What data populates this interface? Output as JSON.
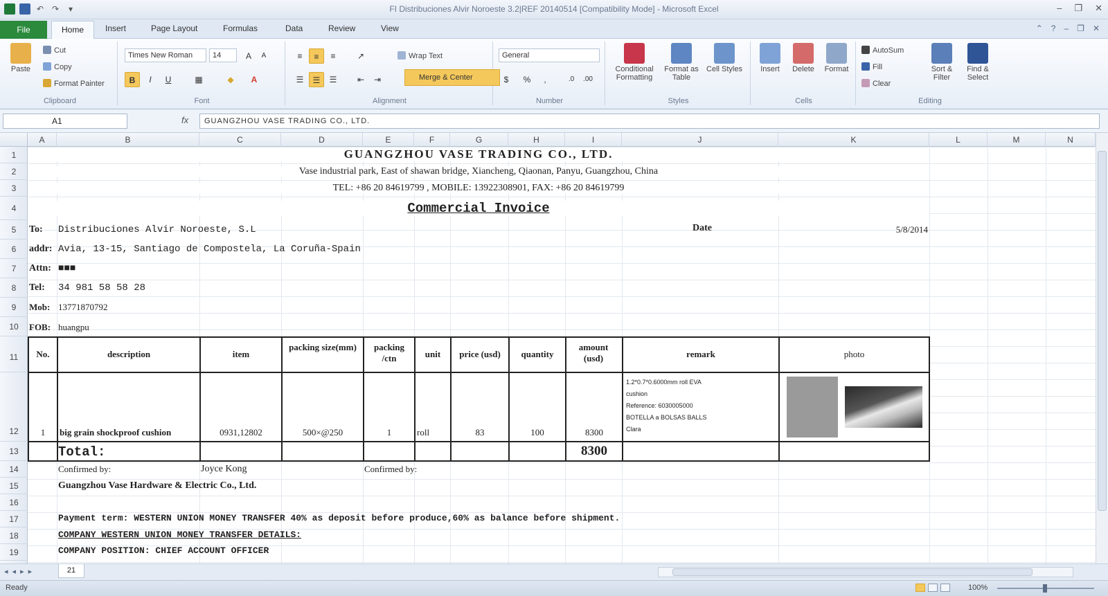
{
  "window": {
    "title": "FI Distribuciones Alvir Noroeste 3.2|REF 20140514 [Compatibility Mode] - Microsoft Excel"
  },
  "ribbon_tabs": [
    "File",
    "Home",
    "Insert",
    "Page Layout",
    "Formulas",
    "Data",
    "Review",
    "View"
  ],
  "ribbon": {
    "clipboard": {
      "label": "Clipboard",
      "paste": "Paste",
      "cut": "Cut",
      "copy": "Copy",
      "format_painter": "Format Painter"
    },
    "font": {
      "label": "Font",
      "name": "Times New Roman",
      "size": "14"
    },
    "alignment": {
      "label": "Alignment",
      "wrap_text": "Wrap Text",
      "merge_center": "Merge & Center"
    },
    "number": {
      "label": "Number",
      "format": "General"
    },
    "styles": {
      "label": "Styles",
      "conditional": "Conditional Formatting",
      "format_table": "Format as Table",
      "cell_styles": "Cell Styles"
    },
    "cells": {
      "label": "Cells",
      "insert": "Insert",
      "delete": "Delete",
      "format": "Format"
    },
    "editing": {
      "label": "Editing",
      "autosum": "AutoSum",
      "fill": "Fill",
      "clear": "Clear",
      "sort_filter": "Sort & Filter",
      "find_select": "Find & Select"
    }
  },
  "formula_bar": {
    "name_box": "A1",
    "fx": "fx",
    "content": "GUANGZHOU VASE TRADING CO., LTD."
  },
  "columns": [
    "A",
    "B",
    "C",
    "D",
    "E",
    "F",
    "G",
    "H",
    "I",
    "J",
    "K",
    "L",
    "M",
    "N"
  ],
  "rows": [
    "1",
    "2",
    "3",
    "4",
    "5",
    "6",
    "7",
    "8",
    "9",
    "10",
    "11",
    "12",
    "13",
    "14",
    "15",
    "16",
    "17",
    "18",
    "19"
  ],
  "invoice": {
    "company": "GUANGZHOU VASE TRADING CO., LTD.",
    "address": "Vase industrial park, East of shawan bridge, Xiancheng, Qiaonan, Panyu, Guangzhou, China",
    "contact": "TEL: +86 20 84619799 , MOBILE: 13922308901, FAX: +86 20 84619799",
    "doc_title": "Commercial Invoice",
    "to_label": "To:",
    "to_value": "Distribuciones Alvir Noroeste, S.L",
    "addr_label": "addr:",
    "addr_value": "Avia, 13-15, Santiago de Compostela, La Coruña-Spain",
    "attn_label": "Attn:",
    "attn_value": "■■■",
    "tel_label": "Tel:",
    "tel_value": "34 981 58 58 28",
    "mob_label": "Mob:",
    "mob_value": "13771870792",
    "fob_label": "FOB:",
    "fob_value": "huangpu",
    "date_label": "Date",
    "date_value": "5/8/2014",
    "headers": [
      "No.",
      "description",
      "item",
      "packing size(mm)",
      "packing /ctn",
      "unit",
      "price (usd)",
      "quantity",
      "amount (usd)",
      "remark",
      "photo"
    ],
    "row": {
      "no": "1",
      "description": "big grain shockproof cushion",
      "item": "0931,12802",
      "packing_size": "500×@250",
      "packing_ctn": "1",
      "unit": "roll",
      "price": "83",
      "quantity": "100",
      "amount": "8300",
      "remark": [
        "1.2*0.7*0.6000mm roll EVA",
        "cushion",
        "Reference: 6030005000",
        "BOTELLA a BOLSAS BALLS",
        "Clara"
      ]
    },
    "total_label": "Total:",
    "total_value": "8300",
    "confirmed_by_1": "Confirmed by:",
    "signer": "Joyce Kong",
    "confirmed_by_2": "Confirmed by:",
    "company2": "Guangzhou Vase Hardware & Electric Co., Ltd.",
    "payment": "Payment term: WESTERN UNION MONEY TRANSFER 40% as deposit before produce,60% as balance before shipment.",
    "company_details": "COMPANY WESTERN UNION MONEY TRANSFER DETAILS:",
    "company_position": "COMPANY POSITION: CHIEF ACCOUNT OFFICER"
  },
  "sheet_tab": "21",
  "status": {
    "ready": "Ready",
    "zoom": "100%"
  },
  "colors": {
    "file_tab": "#2b8a3c",
    "selected_toggle": "#f5c85b"
  }
}
